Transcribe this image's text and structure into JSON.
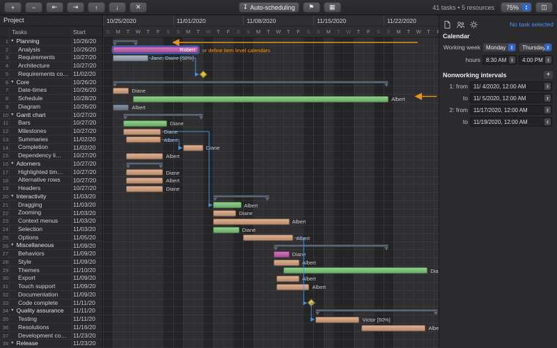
{
  "toolbar": {
    "left_buttons": [
      {
        "name": "add-task-button",
        "glyph": "+"
      },
      {
        "name": "remove-task-button",
        "glyph": "−"
      },
      {
        "name": "outdent-button",
        "glyph": "⇤"
      },
      {
        "name": "indent-button",
        "glyph": "⇥"
      },
      {
        "name": "move-up-button",
        "glyph": "↑"
      },
      {
        "name": "move-down-button",
        "glyph": "↓"
      },
      {
        "name": "delete-task-button",
        "glyph": "✕"
      }
    ],
    "auto_scheduling_label": "Auto-scheduling",
    "auto_scheduling_icon": "↧",
    "flag_icon": "⚑",
    "grid_icon": "▦",
    "panel_icon": "◫",
    "status_text": "41 tasks • 5 resources",
    "zoom_value": "75%"
  },
  "table": {
    "project_label": "Project",
    "columns": [
      "Tasks",
      "Start"
    ],
    "rows": [
      {
        "num": 1,
        "name": "Planning",
        "start": "10/26/20",
        "group": true
      },
      {
        "num": 2,
        "name": "Analysis",
        "start": "10/26/20",
        "group": false
      },
      {
        "num": 3,
        "name": "Requirements",
        "start": "10/27/20",
        "group": false
      },
      {
        "num": 4,
        "name": "Architecture",
        "start": "10/27/20",
        "group": false
      },
      {
        "num": 5,
        "name": "Requirements co…",
        "start": "11/02/20",
        "group": false
      },
      {
        "num": 6,
        "name": "Core",
        "start": "10/26/20",
        "group": true
      },
      {
        "num": 7,
        "name": "Date-times",
        "start": "10/26/20",
        "group": false
      },
      {
        "num": 8,
        "name": "Schedule",
        "start": "10/28/20",
        "group": false
      },
      {
        "num": 9,
        "name": "Diagram",
        "start": "10/26/20",
        "group": false
      },
      {
        "num": 10,
        "name": "Gantt chart",
        "start": "10/27/20",
        "group": true
      },
      {
        "num": 11,
        "name": "Bars",
        "start": "10/27/20",
        "group": false
      },
      {
        "num": 12,
        "name": "Milestones",
        "start": "10/27/20",
        "group": false
      },
      {
        "num": 13,
        "name": "Summaries",
        "start": "11/02/20",
        "group": false
      },
      {
        "num": 14,
        "name": "Completion",
        "start": "11/02/20",
        "group": false
      },
      {
        "num": 15,
        "name": "Dependency li…",
        "start": "10/27/20",
        "group": false
      },
      {
        "num": 16,
        "name": "Adorners",
        "start": "10/27/20",
        "group": true
      },
      {
        "num": 17,
        "name": "Highlighted tim…",
        "start": "10/27/20",
        "group": false
      },
      {
        "num": 18,
        "name": "Alternative rows",
        "start": "10/27/20",
        "group": false
      },
      {
        "num": 19,
        "name": "Headers",
        "start": "10/27/20",
        "group": false
      },
      {
        "num": 20,
        "name": "Interactivity",
        "start": "11/03/20",
        "group": true
      },
      {
        "num": 21,
        "name": "Dragging",
        "start": "11/03/20",
        "group": false
      },
      {
        "num": 22,
        "name": "Zooming",
        "start": "11/03/20",
        "group": false
      },
      {
        "num": 23,
        "name": "Context menus",
        "start": "11/03/20",
        "group": false
      },
      {
        "num": 24,
        "name": "Selection",
        "start": "11/03/20",
        "group": false
      },
      {
        "num": 25,
        "name": "Options",
        "start": "11/05/20",
        "group": false
      },
      {
        "num": 26,
        "name": "Miscellaneous",
        "start": "11/09/20",
        "group": true
      },
      {
        "num": 27,
        "name": "Behaviors",
        "start": "11/09/20",
        "group": false
      },
      {
        "num": 28,
        "name": "Style",
        "start": "11/09/20",
        "group": false
      },
      {
        "num": 29,
        "name": "Themes",
        "start": "11/10/20",
        "group": false
      },
      {
        "num": 30,
        "name": "Export",
        "start": "11/09/20",
        "group": false
      },
      {
        "num": 31,
        "name": "Touch support",
        "start": "11/09/20",
        "group": false
      },
      {
        "num": 32,
        "name": "Documentation",
        "start": "11/09/20",
        "group": false
      },
      {
        "num": 33,
        "name": "Code complete",
        "start": "11/11/20",
        "group": false
      },
      {
        "num": 34,
        "name": "Quality assurance",
        "start": "11/11/20",
        "group": true
      },
      {
        "num": 35,
        "name": "Testing",
        "start": "11/11/20",
        "group": false
      },
      {
        "num": 36,
        "name": "Resolutions",
        "start": "11/16/20",
        "group": false
      },
      {
        "num": 37,
        "name": "Development co…",
        "start": "11/23/20",
        "group": false
      },
      {
        "num": 38,
        "name": "Release",
        "start": "11/23/20",
        "group": true
      }
    ]
  },
  "timeline": {
    "weeks": [
      "10/25/2020",
      "11/01/2020",
      "11/08/2020",
      "11/15/2020",
      "11/22/2020"
    ],
    "day_letters": [
      "S",
      "M",
      "T",
      "W",
      "T",
      "F",
      "S"
    ]
  },
  "gantt": {
    "bars": [
      {
        "row": 1,
        "type": "summary",
        "start": 1,
        "end": 3.5
      },
      {
        "row": 2,
        "type": "task",
        "color": "pink",
        "start": 1,
        "end": 9.5,
        "label": "Robert",
        "label_pos": "inside",
        "selected": true
      },
      {
        "row": 3,
        "type": "task",
        "color": "gray",
        "start": 1,
        "end": 4.5,
        "label": "Jane, Diane [50%]"
      },
      {
        "row": 5,
        "type": "milestone",
        "start": 10
      },
      {
        "row": 6,
        "type": "summary",
        "start": 1,
        "end": 28.5
      },
      {
        "row": 7,
        "type": "task",
        "color": "tan",
        "start": 1,
        "end": 2.6,
        "label": "Diane"
      },
      {
        "row": 8,
        "type": "task",
        "color": "green",
        "start": 3,
        "end": 28.5,
        "label": "Albert"
      },
      {
        "row": 9,
        "type": "task",
        "color": "slate",
        "start": 1,
        "end": 2.6,
        "label": "Albert"
      },
      {
        "row": 10,
        "type": "summary",
        "start": 2,
        "end": 10
      },
      {
        "row": 11,
        "type": "task",
        "color": "green",
        "start": 2,
        "end": 6.4,
        "label": "Diane"
      },
      {
        "row": 12,
        "type": "task",
        "color": "tan",
        "start": 2,
        "end": 5.8,
        "label": "Diane"
      },
      {
        "row": 13,
        "type": "task",
        "color": "tan",
        "start": 2.3,
        "end": 5.8,
        "label": "Albert"
      },
      {
        "row": 14,
        "type": "task",
        "color": "tan",
        "start": 8,
        "end": 10,
        "label": "Diane"
      },
      {
        "row": 15,
        "type": "task",
        "color": "tan",
        "start": 2.3,
        "end": 6,
        "label": "Albert"
      },
      {
        "row": 16,
        "type": "summary",
        "start": 2.3,
        "end": 6
      },
      {
        "row": 17,
        "type": "task",
        "color": "tan",
        "start": 2.3,
        "end": 6,
        "label": "Diane"
      },
      {
        "row": 18,
        "type": "task",
        "color": "tan",
        "start": 2.3,
        "end": 6,
        "label": "Albert"
      },
      {
        "row": 19,
        "type": "task",
        "color": "tan",
        "start": 2.3,
        "end": 6,
        "label": "Diane"
      },
      {
        "row": 20,
        "type": "summary",
        "start": 11,
        "end": 16.6
      },
      {
        "row": 21,
        "type": "task",
        "color": "green",
        "start": 11,
        "end": 13.8,
        "label": "Albert"
      },
      {
        "row": 22,
        "type": "task",
        "color": "tan",
        "start": 11,
        "end": 13.3,
        "label": "Diane"
      },
      {
        "row": 23,
        "type": "task",
        "color": "tan",
        "start": 11,
        "end": 18.6,
        "label": "Albert"
      },
      {
        "row": 24,
        "type": "task",
        "color": "green",
        "start": 11,
        "end": 13.6,
        "label": "Diane"
      },
      {
        "row": 25,
        "type": "task",
        "color": "tan",
        "start": 14,
        "end": 19,
        "label": "Albert"
      },
      {
        "row": 26,
        "type": "summary",
        "start": 17,
        "end": 28.5
      },
      {
        "row": 27,
        "type": "task",
        "color": "pink",
        "start": 17,
        "end": 18.6,
        "label": "Diane"
      },
      {
        "row": 28,
        "type": "task",
        "color": "tan",
        "start": 17,
        "end": 19.6,
        "label": "Albert"
      },
      {
        "row": 29,
        "type": "task",
        "color": "green",
        "start": 18,
        "end": 32.4,
        "label": "Diane"
      },
      {
        "row": 30,
        "type": "task",
        "color": "tan",
        "start": 17.3,
        "end": 19.6,
        "label": "Albert"
      },
      {
        "row": 31,
        "type": "task",
        "color": "tan",
        "start": 17.3,
        "end": 20.6,
        "label": "Albert"
      },
      {
        "row": 33,
        "type": "milestone",
        "start": 20.8
      },
      {
        "row": 34,
        "type": "summary",
        "start": 21.2,
        "end": 33.4
      },
      {
        "row": 35,
        "type": "task",
        "color": "tan",
        "start": 21.2,
        "end": 25.6,
        "label": "Victor [50%]"
      },
      {
        "row": 36,
        "type": "task",
        "color": "tan",
        "start": 25.8,
        "end": 32.2,
        "label": "Albert"
      }
    ],
    "dependencies": [
      {
        "from": 3,
        "to": 5
      },
      {
        "from": 13,
        "to": 14
      },
      {
        "from": 12,
        "to": 21
      },
      {
        "from": 25,
        "to": 33
      },
      {
        "from": 33,
        "to": 35
      }
    ],
    "nonworking_extra_days": [
      10,
      23,
      24
    ],
    "colors": {
      "green": "#7fbf7c",
      "tan": "#cfa183",
      "pink": "#c661ae",
      "gray": "#9aa2ad",
      "slate": "#78818d",
      "summary": "#5d6773",
      "milestone": "#e7c93f",
      "dependency": "#4a8fd4",
      "annotation": "#e8941a",
      "selection": "#2f6bd0"
    }
  },
  "annotations": {
    "note": {
      "row": 2,
      "day": 9.9,
      "text": "or define item level calendars"
    },
    "arrows": [
      {
        "name": "working-week-arrow",
        "y_row": 1.1,
        "from_day": 31.4,
        "to_day": 7.0
      },
      {
        "name": "nonworking-interval-arrow",
        "y_row": 7.7,
        "from_day": 33.3,
        "to_day": 31.2
      }
    ]
  },
  "inspector": {
    "no_task_label": "No task selected",
    "calendar_section": "Calendar",
    "working_week_label": "Working week",
    "working_week_from": "Monday",
    "working_week_to": "Thursday",
    "hours_label": "hours",
    "hours_from": "8:30 AM",
    "hours_to": "4:00 PM",
    "nonworking_section": "Nonworking intervals",
    "add_interval_label": "+",
    "intervals": [
      {
        "label": "1: from",
        "value": "11/ 4/2020, 12:00 AM"
      },
      {
        "label": "to",
        "value": "11/ 5/2020, 12:00 AM"
      },
      {
        "label": "2: from",
        "value": "11/17/2020, 12:00 AM"
      },
      {
        "label": "to",
        "value": "11/19/2020, 12:00 AM"
      }
    ]
  }
}
